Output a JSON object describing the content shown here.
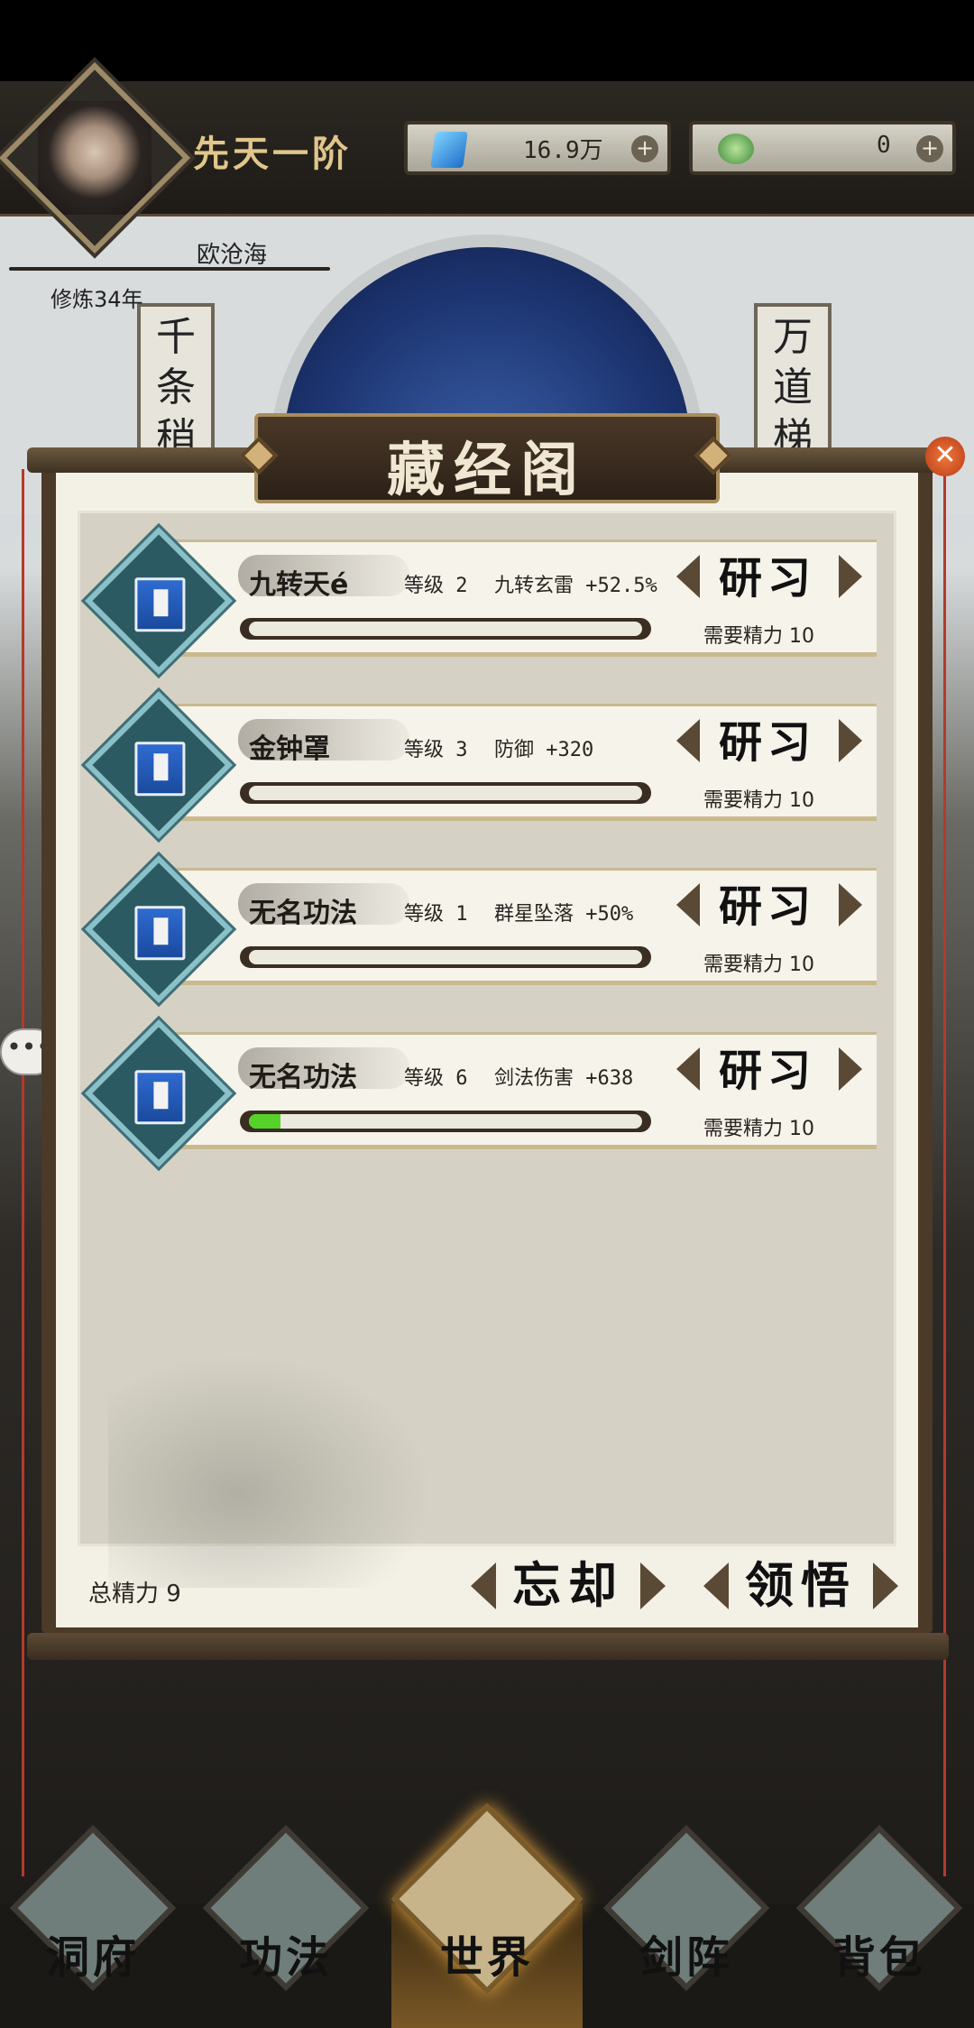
{
  "header": {
    "realm": "先天一阶",
    "spirit_stones": "16.9万",
    "jade": "0",
    "plus": "+"
  },
  "player": {
    "name": "欧沧海",
    "cultivation": "修炼34年"
  },
  "background": {
    "banner_left": "千条稍",
    "banner_right": "万道梯"
  },
  "panel": {
    "title": "藏经阁",
    "close": "✕",
    "total_energy_label": "总精力",
    "total_energy_value": "9",
    "forget_button": "忘却",
    "comprehend_button": "领悟"
  },
  "techniques": [
    {
      "name": "九转天é",
      "level": "等级 2",
      "effect": "九转玄雷 +52.5%",
      "button": "研习",
      "cost": "需要精力 10",
      "progress": 0.0
    },
    {
      "name": "金钟罩",
      "level": "等级 3",
      "effect": "防御 +320",
      "button": "研习",
      "cost": "需要精力 10",
      "progress": 0.0
    },
    {
      "name": "无名功法",
      "level": "等级 1",
      "effect": "群星坠落 +50%",
      "button": "研习",
      "cost": "需要精力 10",
      "progress": 0.0
    },
    {
      "name": "无名功法",
      "level": "等级 6",
      "effect": "剑法伤害 +638",
      "button": "研习",
      "cost": "需要精力 10",
      "progress": 0.08
    }
  ],
  "chat": {
    "dots": "•••"
  },
  "nav": [
    {
      "label": "洞府",
      "icon": "cave-mansion-icon"
    },
    {
      "label": "功法",
      "icon": "technique-book-icon"
    },
    {
      "label": "世界",
      "icon": "world-scroll-icon"
    },
    {
      "label": "剑阵",
      "icon": "sword-array-icon"
    },
    {
      "label": "背包",
      "icon": "backpack-icon"
    }
  ]
}
